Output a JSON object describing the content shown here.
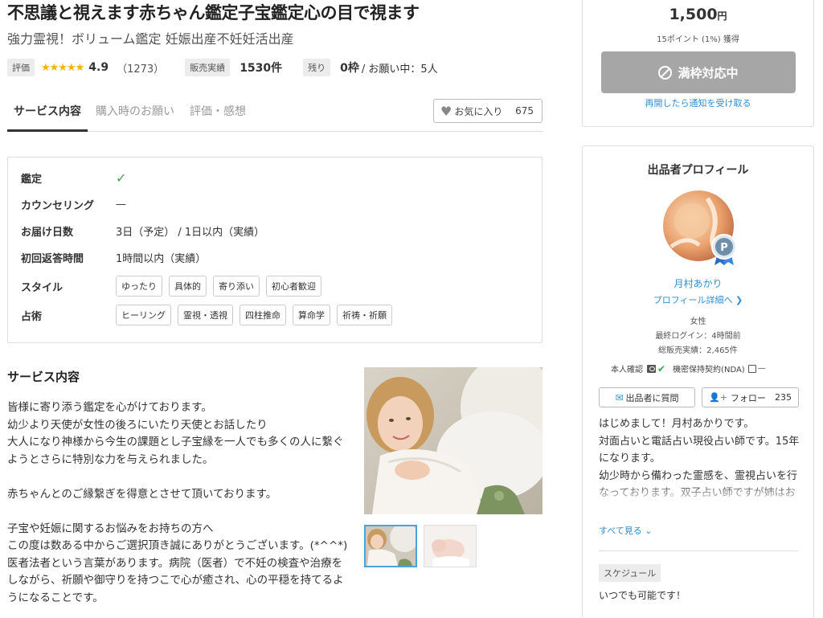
{
  "service": {
    "title": "不思議と視えます赤ちゃん鑑定子宝鑑定心の目で視ます",
    "subtitle": "強力霊視！ボリューム鑑定 妊娠出産不妊妊活出産"
  },
  "stats": {
    "rating_label": "評価",
    "stars": "★★★★★",
    "rating_value": "4.9",
    "rating_count": "（1273）",
    "sales_label": "販売実績",
    "sales_value": "1530件",
    "remaining_label": "残り",
    "remaining_value": "0枠",
    "remaining_sub": "/ お願い中：5人"
  },
  "tabs": [
    {
      "label": "サービス内容"
    },
    {
      "label": "購入時のお願い"
    },
    {
      "label": "評価・感想"
    }
  ],
  "favorite": {
    "label": "お気に入り",
    "count": "675"
  },
  "info": {
    "rows": [
      {
        "key": "鑑定",
        "value": "✓"
      },
      {
        "key": "カウンセリング",
        "value": "—"
      },
      {
        "key": "お届け日数",
        "value": "3日（予定） / 1日以内（実績）"
      },
      {
        "key": "初回返答時間",
        "value": "1時間以内（実績）"
      },
      {
        "key": "スタイル",
        "chips": [
          "ゆったり",
          "具体的",
          "寄り添い",
          "初心者歓迎"
        ]
      },
      {
        "key": "占術",
        "chips": [
          "ヒーリング",
          "霊視・透視",
          "四柱推命",
          "算命学",
          "祈祷・祈願"
        ]
      }
    ]
  },
  "description": {
    "title": "サービス内容",
    "lines": [
      "皆様に寄り添う鑑定を心がけております。",
      "幼少より天使が女性の後ろにいたり天使とお話したり",
      "大人になり神様から今生の課題とし子宝縁を一人でも多くの人に繋ぐようとさらに特別な力を与えられました。",
      "",
      "赤ちゃんとのご縁繋ぎを得意とさせて頂いております。",
      "",
      "子宝や妊娠に関するお悩みをお持ちの方へ",
      "この度は数ある中からご選択頂き誠にありがとうございます。(*^^*)",
      "医者法者という言葉があります。病院（医者）で不妊の検査や治療をしながら、祈願や御守りを持つこで心が癒され、心の平穏を持てるようになることです。"
    ]
  },
  "purchase": {
    "price": "1,500",
    "currency": "円",
    "points": "15ポイント (1%) 獲得",
    "full_button": "満枠対応中",
    "notify_link": "再開したら通知を受け取る"
  },
  "profile": {
    "title": "出品者プロフィール",
    "name": "月村あかり",
    "detail_link": "プロフィール詳細へ ❯",
    "gender": "女性",
    "last_login": "最終ログイン：4時間前",
    "total_sales": "総販売実績：2,465件",
    "identity_label": "本人確認",
    "nda_label": "機密保持契約(NDA)",
    "nda_value": "—",
    "question_button": "出品者に質問",
    "follow_button": "フォロー",
    "follow_count": "235",
    "bio_lines": [
      "はじめまして！月村あかりです。",
      "対面占いと電話占い現役占い師です。15年になります。",
      "幼少時から備わった霊感を、霊視占いを行なっております。双子占い師ですが姉はお休みしています…"
    ],
    "see_all": "すべて見る ⌄",
    "schedule_label": "スケジュール",
    "schedule_text": "いつでも可能です！"
  },
  "icons": {
    "favorite": "heart-icon",
    "check": "check-icon",
    "ban": "ban-icon",
    "mail": "mail-icon",
    "follow": "user-plus-icon",
    "id": "id-card-icon",
    "nda": "document-icon"
  },
  "colors": {
    "link": "#2f8ed3",
    "star": "#f5b301",
    "check": "#3aa54b",
    "disabled_button": "#a6a6a6"
  }
}
